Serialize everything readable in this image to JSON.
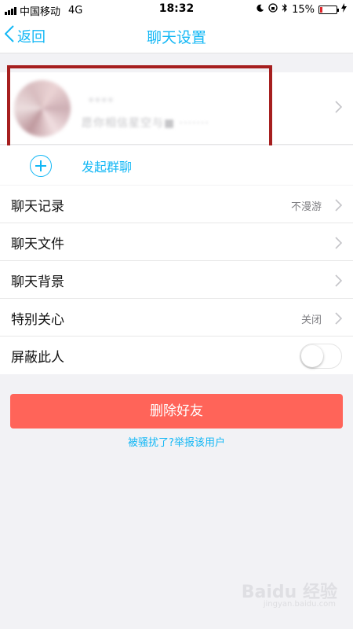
{
  "status_bar": {
    "carrier": "中国移动",
    "network": "4G",
    "time": "18:32",
    "battery": "15%",
    "battery_level": 0.15
  },
  "nav": {
    "back_label": "返回",
    "title": "聊天设置"
  },
  "profile": {
    "name": "••••",
    "signature": "愿你相信星空与■ ·······"
  },
  "group_chat_label": "发起群聊",
  "settings": {
    "chat_history": {
      "label": "聊天记录",
      "value": "不漫游"
    },
    "chat_files": {
      "label": "聊天文件"
    },
    "chat_background": {
      "label": "聊天背景"
    },
    "special_care": {
      "label": "特别关心",
      "value": "关闭"
    },
    "block_user": {
      "label": "屏蔽此人",
      "enabled": false
    }
  },
  "delete_button": "删除好友",
  "report_link": "被骚扰了?举报该用户",
  "watermark": {
    "logo": "Baidu 经验",
    "url": "jingyan.baidu.com"
  },
  "colors": {
    "accent": "#12b7f5",
    "danger": "#ff6459",
    "highlight": "#a61f1f"
  }
}
